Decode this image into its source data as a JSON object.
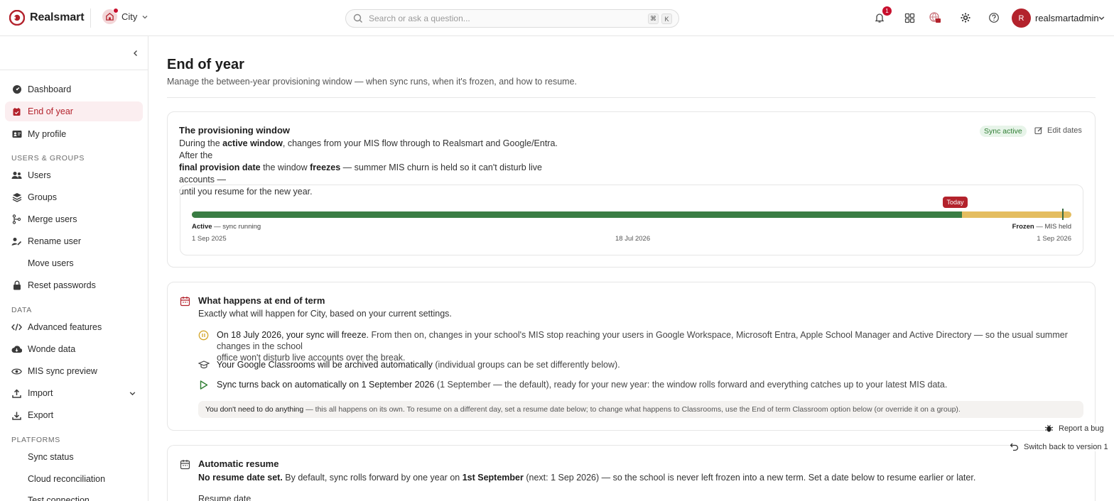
{
  "app": {
    "name": "Realsmart",
    "brand_color": "#b3222c"
  },
  "tenant": {
    "name": "City"
  },
  "search": {
    "placeholder": "Search or ask a question...",
    "shortcut_1": "⌘",
    "shortcut_2": "K"
  },
  "header": {
    "notification_count": "1",
    "avatar_initial": "R",
    "username": "realsmartadmin"
  },
  "sidebar": {
    "items_top": [
      {
        "label": "Dashboard"
      },
      {
        "label": "End of year"
      },
      {
        "label": "My profile"
      }
    ],
    "section_users": "USERS & GROUPS",
    "items_users": [
      {
        "label": "Users"
      },
      {
        "label": "Groups"
      },
      {
        "label": "Merge users"
      },
      {
        "label": "Rename user"
      },
      {
        "label": "Move users"
      },
      {
        "label": "Reset passwords"
      }
    ],
    "section_data": "DATA",
    "items_data": [
      {
        "label": "Advanced features"
      },
      {
        "label": "Wonde data"
      },
      {
        "label": "MIS sync preview"
      },
      {
        "label": "Import"
      },
      {
        "label": "Export"
      }
    ],
    "section_platforms": "PLATFORMS",
    "items_platforms": [
      {
        "label": "Sync status"
      },
      {
        "label": "Cloud reconciliation"
      },
      {
        "label": "Test connection"
      }
    ]
  },
  "page": {
    "title": "End of year",
    "subtitle": "Manage the between-year provisioning window — when sync runs, when it's frozen, and how to resume."
  },
  "provisioning": {
    "title": "The provisioning window",
    "text_1": "During the ",
    "text_active": "active window",
    "text_2": ", changes from your MIS flow through to Realsmart and Google/Entra. After the",
    "text_final": "final provision date",
    "text_3": " the window ",
    "text_freezes": "freezes",
    "text_4": " — summer MIS churn is held so it can't disturb live accounts —",
    "text_5": "until you resume for the new year.",
    "badge": "Sync active",
    "edit_label": "Edit dates",
    "timeline": {
      "active_progress": 0.876,
      "today_label": "Today",
      "active_label": "Active",
      "active_desc": " — sync running",
      "frozen_label": "Frozen",
      "frozen_desc": " — MIS held",
      "start_date": "1 Sep 2025",
      "freeze_date": "18 Jul 2026",
      "end_date": "1 Sep 2026"
    }
  },
  "end_of_term": {
    "title": "What happens at end of term",
    "subtitle": "Exactly what will happen for City, based on your current settings.",
    "freeze_strong": "On 18 July 2026, your sync will freeze.",
    "freeze_rest_1": " From then on, changes in your school's MIS stop reaching your users in Google Workspace, Microsoft Entra, Apple School Manager and Active Directory — so the usual summer changes in the school",
    "freeze_rest_2": "office won't disturb live accounts over the break.",
    "classroom_strong": "Your Google Classrooms will be archived automatically",
    "classroom_rest": " (individual groups can be set differently below).",
    "resume_strong": "Sync turns back on automatically on 1 September 2026",
    "resume_rest": " (1 September — the default), ready for your new year: the window rolls forward and everything catches up to your latest MIS data.",
    "note_strong": "You don't need to do anything",
    "note_rest": "— this all happens on its own. To resume on a different day, set a resume date below; to change what happens to Classrooms, use the End of term Classroom option below (or override it on a group)."
  },
  "auto_resume": {
    "title": "Automatic resume",
    "strong": "No resume date set.",
    "text_1": " By default, sync rolls forward by one year on ",
    "date_strong": "1st September",
    "text_2": " (next: 1 Sep 2026) — so the school is never left frozen into a new term. Set a date below to resume earlier or later.",
    "field_label": "Resume date"
  },
  "floating": {
    "report_bug": "Report a bug",
    "switch_version": "Switch back to version 1"
  }
}
